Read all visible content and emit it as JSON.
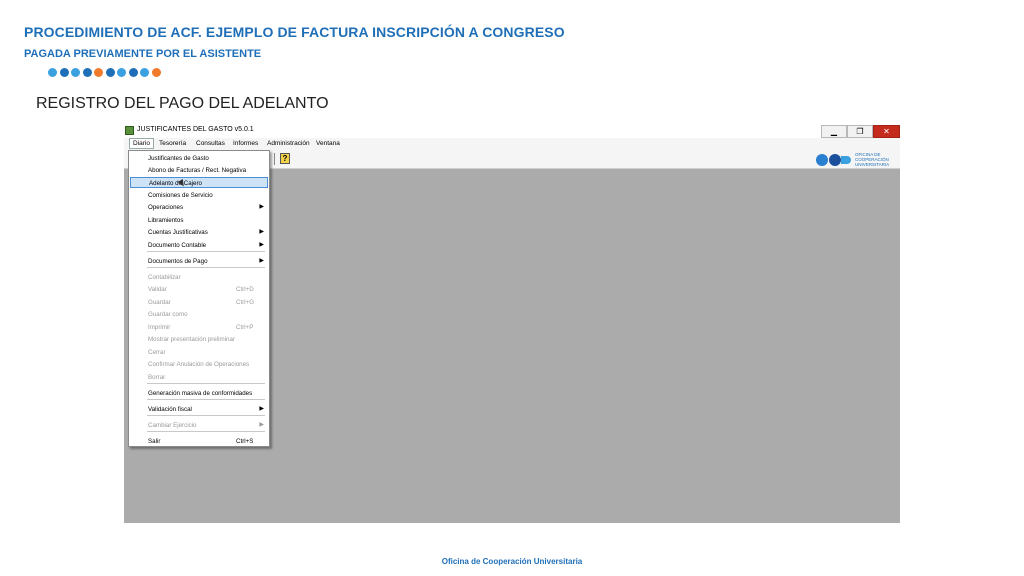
{
  "slide": {
    "title": "PROCEDIMIENTO DE ACF. EJEMPLO DE FACTURA INSCRIPCIÓN A CONGRESO",
    "subtitle": "PAGADA PREVIAMENTE POR EL ASISTENTE",
    "heading": "REGISTRO DEL PAGO DEL ADELANTO",
    "footer": "Oficina de Cooperación Universitaria",
    "dot_colors": [
      "#3aa0e0",
      "#1f6fb8",
      "#3aa0e0",
      "#1f6fb8",
      "#f07a2a",
      "#1f6fb8",
      "#3aa0e0",
      "#1f6fb8",
      "#3aa0e0",
      "#f07a2a"
    ]
  },
  "window": {
    "title": "JUSTIFICANTES DEL GASTO v5.0.1",
    "minimize": "▁",
    "restore": "❐",
    "close": "✕"
  },
  "menubar": [
    "Diario",
    "Tesorería",
    "Consultas",
    "Informes",
    "Administración",
    "Ventana"
  ],
  "toolbar": {
    "help": "?"
  },
  "logo": {
    "line1": "OFICINA DE",
    "line2": "COOPERACIÓN",
    "line3": "UNIVERSITARIA"
  },
  "menu": [
    {
      "label": "Justificantes de Gasto",
      "shortcut": "",
      "submenu": false,
      "disabled": false
    },
    {
      "label": "Abono de Facturas / Rect. Negativa",
      "shortcut": "",
      "submenu": false,
      "disabled": false
    },
    {
      "label": "Adelanto de Cajero",
      "shortcut": "",
      "submenu": false,
      "disabled": false,
      "selected": true
    },
    {
      "label": "Comisiones de Servicio",
      "shortcut": "",
      "submenu": false,
      "disabled": false
    },
    {
      "label": "Operaciones",
      "shortcut": "",
      "submenu": true,
      "disabled": false
    },
    {
      "label": "Libramientos",
      "shortcut": "",
      "submenu": false,
      "disabled": false
    },
    {
      "label": "Cuentas Justificativas",
      "shortcut": "",
      "submenu": true,
      "disabled": false
    },
    {
      "label": "Documento Contable",
      "shortcut": "",
      "submenu": true,
      "disabled": false
    },
    {
      "label": "Documentos de Pago",
      "shortcut": "",
      "submenu": true,
      "disabled": false
    },
    {
      "label": "Contabilizar",
      "shortcut": "",
      "submenu": false,
      "disabled": true
    },
    {
      "label": "Validar",
      "shortcut": "Ctrl+D",
      "submenu": false,
      "disabled": true
    },
    {
      "label": "Guardar",
      "shortcut": "Ctrl+G",
      "submenu": false,
      "disabled": true
    },
    {
      "label": "Guardar como",
      "shortcut": "",
      "submenu": false,
      "disabled": true
    },
    {
      "label": "Imprimir",
      "shortcut": "Ctrl+P",
      "submenu": false,
      "disabled": true
    },
    {
      "label": "Mostrar presentación preliminar",
      "shortcut": "",
      "submenu": false,
      "disabled": true
    },
    {
      "label": "Cerrar",
      "shortcut": "",
      "submenu": false,
      "disabled": true
    },
    {
      "label": "Confirmar Anulación de Operaciones",
      "shortcut": "",
      "submenu": false,
      "disabled": true
    },
    {
      "label": "Borrar",
      "shortcut": "",
      "submenu": false,
      "disabled": true
    },
    {
      "label": "Generación masiva de conformidades",
      "shortcut": "",
      "submenu": false,
      "disabled": false
    },
    {
      "label": "Validación fiscal",
      "shortcut": "",
      "submenu": true,
      "disabled": false
    },
    {
      "label": "Cambiar Ejercicio",
      "shortcut": "",
      "submenu": true,
      "disabled": true
    },
    {
      "label": "Salir",
      "shortcut": "Ctrl+S",
      "submenu": false,
      "disabled": false
    }
  ]
}
